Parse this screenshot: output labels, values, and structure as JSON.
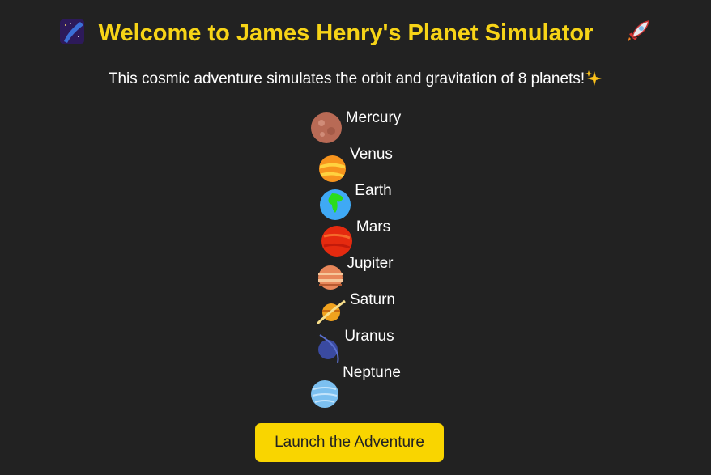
{
  "header": {
    "title": "Welcome to James Henry's Planet Simulator",
    "left_icon": "milky-way-icon",
    "right_icon": "rocket-icon"
  },
  "subtitle": {
    "text": "This cosmic adventure simulates the orbit and gravitation of 8 planets!",
    "icon": "sparkles-icon"
  },
  "planets": [
    {
      "name": "Mercury",
      "color": "#b86a55"
    },
    {
      "name": "Venus",
      "color": "#f7941d"
    },
    {
      "name": "Earth",
      "color": "#3fa9f5"
    },
    {
      "name": "Mars",
      "color": "#e52a0f"
    },
    {
      "name": "Jupiter",
      "color": "#e8875a"
    },
    {
      "name": "Saturn",
      "color": "#f0a21e"
    },
    {
      "name": "Uranus",
      "color": "#3a4aa0"
    },
    {
      "name": "Neptune",
      "color": "#7cc0f0"
    }
  ],
  "button": {
    "label": "Launch the Adventure"
  }
}
